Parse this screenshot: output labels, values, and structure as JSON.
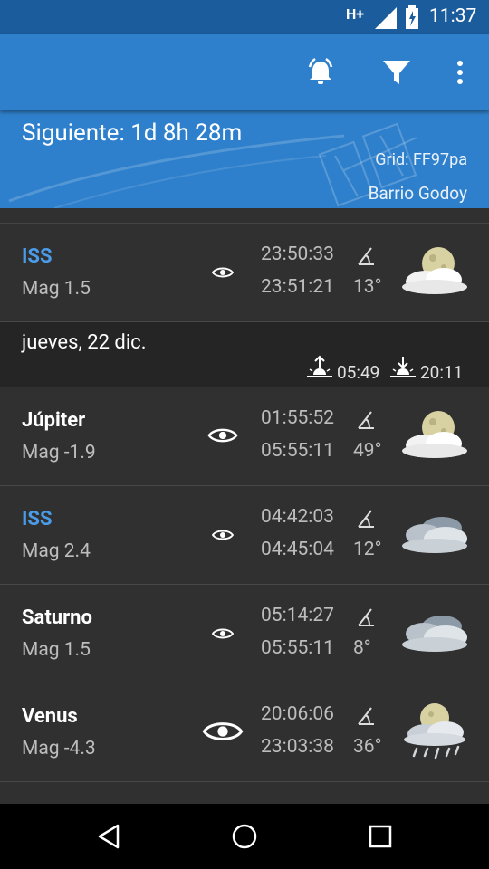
{
  "status": {
    "network": "H+",
    "time": "11:37"
  },
  "header": {
    "next_label": "Siguiente:  1d 8h 28m",
    "grid": "Grid:  FF97pa",
    "location": "Barrio Godoy"
  },
  "passes": [
    {
      "name": "ISS",
      "mag": "Mag 1.5",
      "start": "23:50:33",
      "end": "23:51:21",
      "elevation": "13°",
      "weather": "partly-cloudy-night"
    },
    {
      "name": "Júpiter",
      "mag": "Mag -1.9",
      "start": "01:55:52",
      "end": "05:55:11",
      "elevation": "49°",
      "weather": "partly-cloudy-night"
    },
    {
      "name": "ISS",
      "mag": "Mag 2.4",
      "start": "04:42:03",
      "end": "04:45:04",
      "elevation": "12°",
      "weather": "cloudy"
    },
    {
      "name": "Saturno",
      "mag": "Mag 1.5",
      "start": "05:14:27",
      "end": "05:55:11",
      "elevation": "8°",
      "weather": "cloudy"
    },
    {
      "name": "Venus",
      "mag": "Mag -4.3",
      "start": "20:06:06",
      "end": "23:03:38",
      "elevation": "36°",
      "weather": "rain-night"
    }
  ],
  "day_header": {
    "date": "jueves, 22 dic.",
    "sunrise": "05:49",
    "sunset": "20:11"
  },
  "colors": {
    "primary": "#2f80cc",
    "status": "#1b5c9d",
    "accent_blue": "#4a9be8",
    "background": "#303030"
  }
}
